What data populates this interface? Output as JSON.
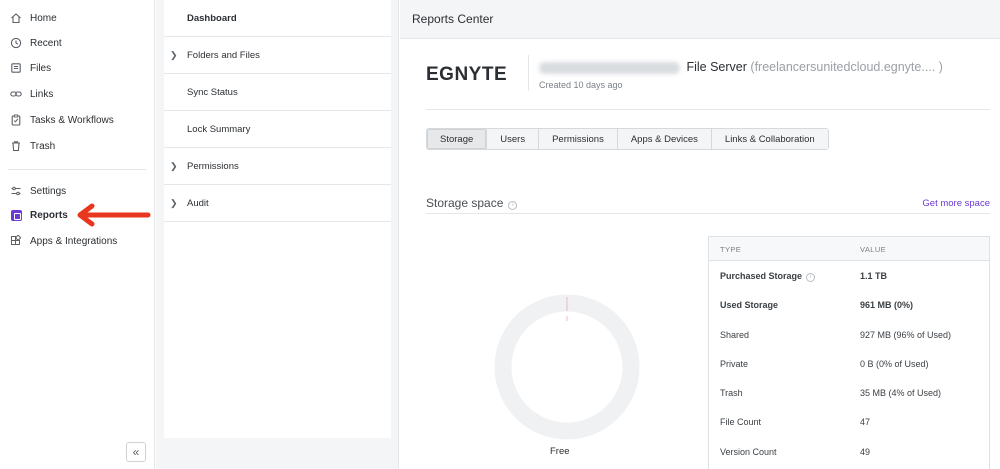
{
  "sidebar": {
    "items": [
      {
        "label": "Home",
        "icon": "home-icon"
      },
      {
        "label": "Recent",
        "icon": "clock-icon"
      },
      {
        "label": "Files",
        "icon": "files-icon"
      },
      {
        "label": "Links",
        "icon": "link-icon"
      },
      {
        "label": "Tasks & Workflows",
        "icon": "clipboard-icon"
      },
      {
        "label": "Trash",
        "icon": "trash-icon"
      },
      {
        "label": "Settings",
        "icon": "sliders-icon"
      },
      {
        "label": "Reports",
        "icon": "reports-icon"
      },
      {
        "label": "Apps & Integrations",
        "icon": "apps-icon"
      }
    ],
    "collapse_glyph": "«",
    "accent_color": "#6c3bd2",
    "annotation_arrow_color": "#e8361f"
  },
  "reports_menu": {
    "items": [
      {
        "label": "Dashboard"
      },
      {
        "label": "Folders and Files"
      },
      {
        "label": "Sync Status"
      },
      {
        "label": "Lock Summary"
      },
      {
        "label": "Permissions"
      },
      {
        "label": "Audit"
      }
    ]
  },
  "main": {
    "title": "Reports Center",
    "brand_logo_text": "EGNYTE",
    "server": {
      "label": "File Server",
      "domain": "(freelancersunitedcloud.egnyte.... )",
      "created": "Created 10 days ago"
    },
    "tabs": [
      {
        "label": "Storage"
      },
      {
        "label": "Users"
      },
      {
        "label": "Permissions"
      },
      {
        "label": "Apps & Devices"
      },
      {
        "label": "Links & Collaboration"
      }
    ],
    "storage": {
      "title": "Storage space",
      "get_more_link": "Get more space",
      "donut_label": "Free",
      "used_fraction": 0.0,
      "table": {
        "headers": [
          "TYPE",
          "VALUE"
        ],
        "rows": [
          {
            "type": "Purchased Storage",
            "value": "1.1 TB"
          },
          {
            "type": "Used Storage",
            "value": "961 MB (0%)"
          },
          {
            "type": "Shared",
            "value": "927 MB (96% of Used)"
          },
          {
            "type": "Private",
            "value": "0 B (0% of Used)"
          },
          {
            "type": "Trash",
            "value": "35 MB (4% of Used)"
          },
          {
            "type": "File Count",
            "value": "47"
          },
          {
            "type": "Version Count",
            "value": "49"
          }
        ]
      }
    }
  }
}
